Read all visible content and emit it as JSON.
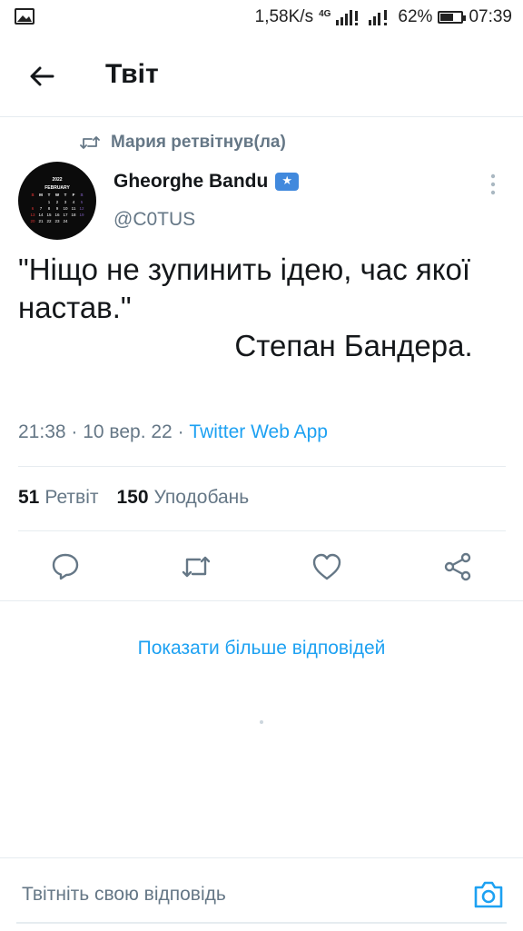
{
  "status_bar": {
    "net_speed": "1,58K/s",
    "network": "4G",
    "battery": "62%",
    "battery_level": 0.62,
    "time": "07:39"
  },
  "header": {
    "title": "Твіт"
  },
  "retweet": {
    "text": "Мария ретвітнув(ла)"
  },
  "author": {
    "name": "Gheorghe Bandu",
    "handle": "@C0TUS",
    "avatar": {
      "year": "2022",
      "month": "FEBRUARY",
      "weekdays": [
        "S",
        "M",
        "T",
        "W",
        "T",
        "F",
        "S"
      ],
      "rows": [
        [
          "",
          "",
          "1",
          "2",
          "3",
          "4",
          "5"
        ],
        [
          "6",
          "7",
          "8",
          "9",
          "10",
          "11",
          "12"
        ],
        [
          "13",
          "14",
          "15",
          "16",
          "17",
          "18",
          "19"
        ],
        [
          "20",
          "21",
          "22",
          "23",
          "24",
          "",
          ""
        ]
      ]
    }
  },
  "tweet": {
    "text": "\"Ніщо не зупинить ідею, час якої настав.\"\n                          Степан Бандера.",
    "time": "21:38",
    "date": "10 вер. 22",
    "source": "Twitter Web App"
  },
  "stats": {
    "retweets_count": "51",
    "retweets_label": "Ретвіт",
    "likes_count": "150",
    "likes_label": "Уподобань"
  },
  "actions": {
    "reply_icon": "reply-icon",
    "retweet_icon": "retweet-icon",
    "like_icon": "heart-icon",
    "share_icon": "share-icon"
  },
  "show_more": "Показати більше відповідей",
  "reply_bar": {
    "placeholder": "Твітніть свою відповідь"
  },
  "colors": {
    "accent": "#1da1f2",
    "muted": "#657786",
    "text": "#14171a"
  }
}
